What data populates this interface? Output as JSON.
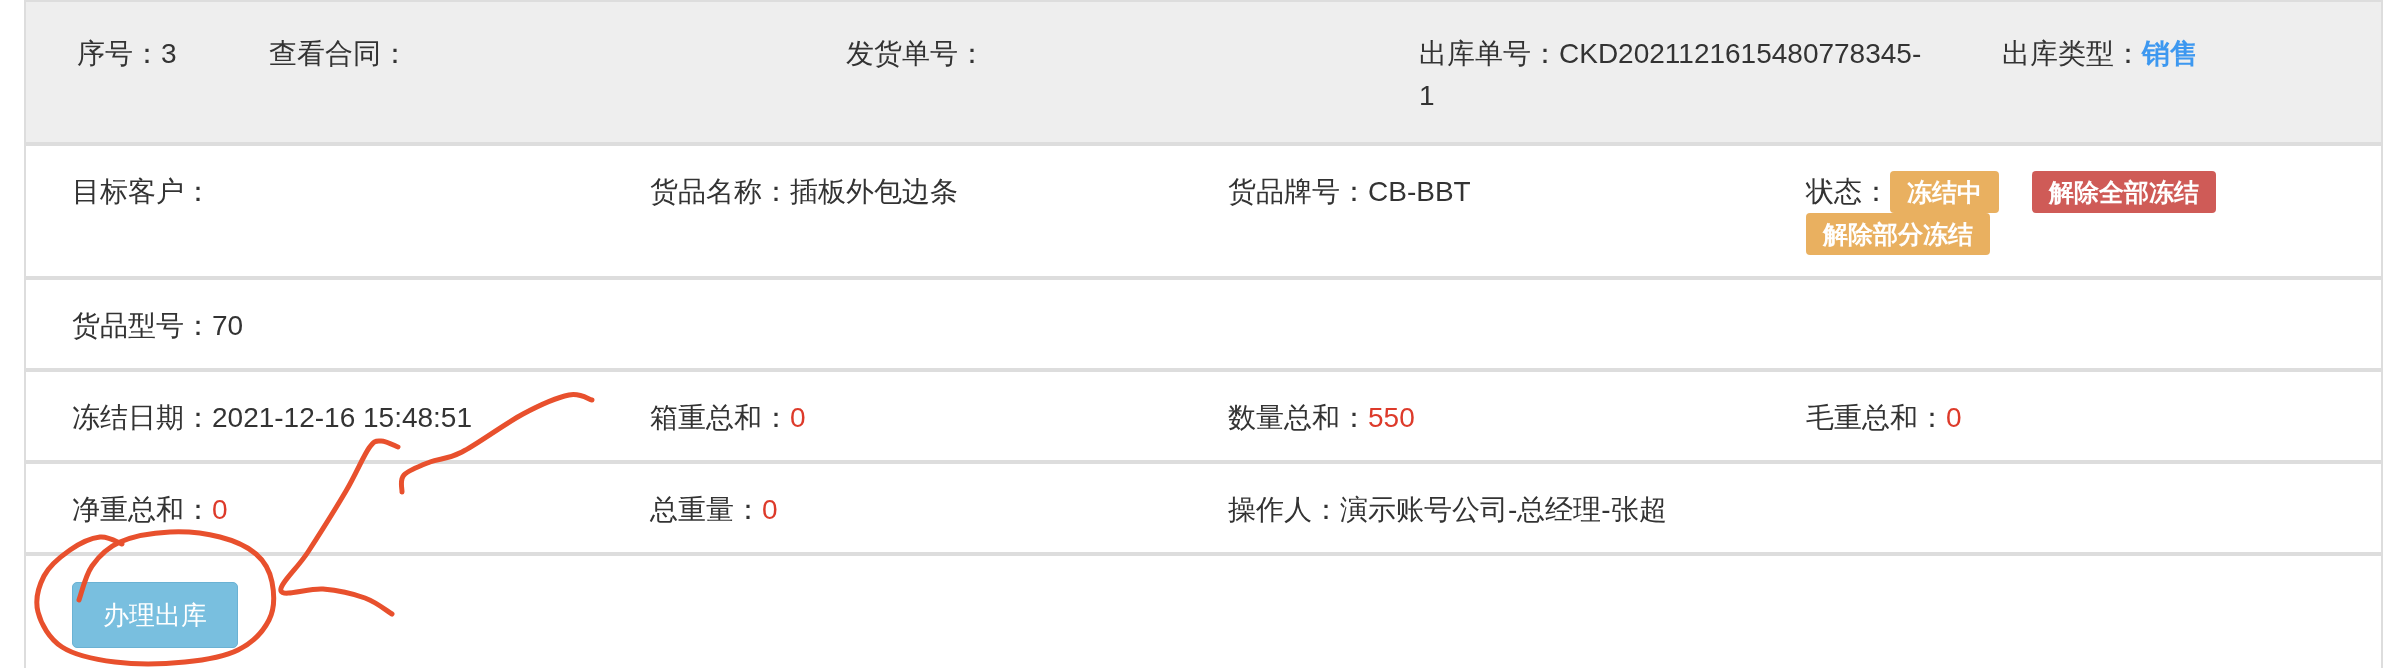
{
  "header_row": [
    {
      "kind": "text",
      "label": "序号：",
      "value": "3",
      "color": "#333333"
    },
    {
      "kind": "text",
      "label": "查看合同："
    },
    {
      "kind": "text",
      "label": "发货单号："
    },
    {
      "kind": "text",
      "label": "出库单号：",
      "value": "CKD2021121615480778345-1",
      "color": "#333333"
    },
    {
      "kind": "link",
      "label": "出库类型：",
      "value": "销售",
      "color": "#3d98f0"
    }
  ],
  "rows": [
    [
      {
        "kind": "text",
        "label": "目标客户："
      },
      {
        "kind": "text",
        "label": "货品名称：",
        "value": "插板外包边条",
        "color": "#333333"
      },
      {
        "kind": "text",
        "label": "货品牌号：",
        "value": "CB-BBT",
        "color": "#333333"
      },
      {
        "kind": "status",
        "label": "状态：",
        "badge": "冻结中",
        "actions": [
          {
            "kind": "danger",
            "label": "解除全部冻结"
          },
          {
            "kind": "warning",
            "label": "解除部分冻结"
          }
        ]
      }
    ],
    [
      {
        "kind": "text",
        "label": "货品型号：",
        "value": "70",
        "color": "#333333"
      }
    ],
    [
      {
        "kind": "text",
        "label": "冻结日期：",
        "value": "2021-12-16 15:48:51",
        "color": "#333333"
      },
      {
        "kind": "text",
        "label": "箱重总和：",
        "value": "0",
        "color": "#dd3a2a"
      },
      {
        "kind": "text",
        "label": "数量总和：",
        "value": "550",
        "color": "#dd3a2a"
      },
      {
        "kind": "text",
        "label": "毛重总和：",
        "value": "0",
        "color": "#dd3a2a"
      }
    ],
    [
      {
        "kind": "text",
        "label": "净重总和：",
        "value": "0",
        "color": "#dd3a2a"
      },
      {
        "kind": "text",
        "label": "总重量：",
        "value": "0",
        "color": "#dd3a2a"
      },
      {
        "kind": "text",
        "label": "操作人：",
        "value": "演示账号公司-总经理-张超",
        "color": "#333333"
      }
    ]
  ],
  "footer_button": {
    "label": "办理出库"
  }
}
